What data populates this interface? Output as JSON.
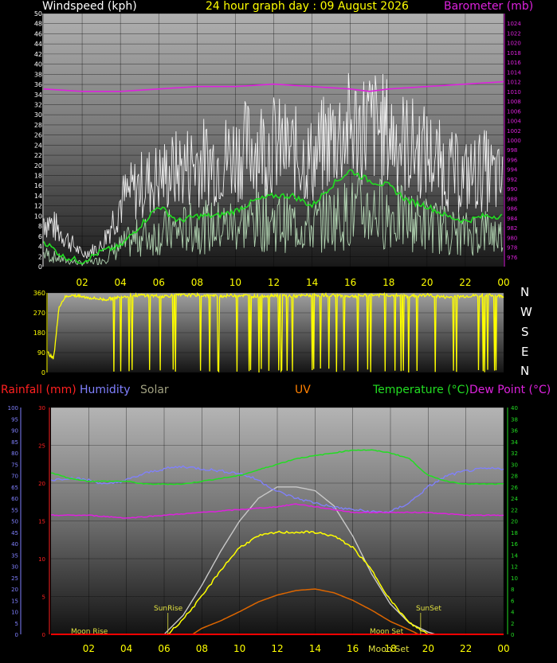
{
  "header": {
    "windspeed": "Windspeed (kph)",
    "title": "24 hour graph day : 09 August 2026",
    "barometer": "Barometer (mb)"
  },
  "compass": [
    "N",
    "W",
    "S",
    "E",
    "N"
  ],
  "legend": {
    "rainfall": "Rainfall (mm)",
    "humidity": "Humidity",
    "solar": "Solar",
    "uv": "UV",
    "temperature": "Temperature (°C)",
    "dewpoint": "Dew Point (°C)"
  },
  "annotations": {
    "sunrise": "SunRise",
    "sunset": "SunSet",
    "moonrise": "Moon Rise",
    "moonset": "Moon Set"
  },
  "colors": {
    "wind": "#ffffff",
    "avgwind": "#c8f0c8",
    "barometer": "#dd22dd",
    "direction": "#ffff00",
    "temperature": "#22dd22",
    "dewpoint": "#dd22dd",
    "humidity": "#8080ff",
    "solar": "#c8c8c8",
    "uv": "#dd6600",
    "rain": "#ff0000"
  },
  "chart_data": [
    {
      "type": "line",
      "x_ticks": [
        "02",
        "04",
        "06",
        "08",
        "10",
        "12",
        "14",
        "16",
        "18",
        "20",
        "22",
        "00"
      ],
      "x_range_hours": [
        0,
        24
      ],
      "ylim_left": [
        0,
        50
      ],
      "y_ticks_left": [
        0,
        2,
        4,
        6,
        8,
        10,
        12,
        14,
        16,
        18,
        20,
        22,
        24,
        26,
        28,
        30,
        32,
        34,
        36,
        38,
        40,
        42,
        44,
        46,
        48,
        50
      ],
      "ylim_right": [
        974,
        1026
      ],
      "y_ticks_right": [
        976,
        978,
        980,
        982,
        984,
        986,
        988,
        990,
        992,
        994,
        996,
        998,
        1000,
        1002,
        1004,
        1006,
        1008,
        1010,
        1012,
        1014,
        1016,
        1018,
        1020,
        1022,
        1024
      ],
      "series": [
        {
          "key": "wind_gust",
          "axis": "left",
          "x": [
            0,
            1,
            2,
            3,
            4,
            5,
            6,
            7,
            8,
            9,
            10,
            11,
            12,
            13,
            14,
            15,
            16,
            17,
            18,
            19,
            20,
            21,
            22,
            23,
            24
          ],
          "y": [
            12,
            8,
            3,
            5,
            16,
            20,
            22,
            24,
            26,
            26,
            28,
            30,
            30,
            28,
            26,
            32,
            34,
            35,
            33,
            30,
            28,
            24,
            22,
            24,
            20
          ]
        },
        {
          "key": "wind_speed",
          "axis": "left",
          "x": [
            0,
            1,
            2,
            3,
            4,
            5,
            6,
            7,
            8,
            9,
            10,
            11,
            12,
            13,
            14,
            15,
            16,
            17,
            18,
            19,
            20,
            21,
            22,
            23,
            24
          ],
          "y": [
            4,
            2,
            1,
            2,
            6,
            9,
            10,
            11,
            12,
            12,
            13,
            14,
            14,
            13,
            12,
            15,
            16,
            17,
            16,
            14,
            13,
            11,
            10,
            11,
            9
          ]
        },
        {
          "key": "avg_wind",
          "axis": "left",
          "x": [
            0,
            1,
            2,
            3,
            4,
            5,
            6,
            7,
            8,
            9,
            10,
            11,
            12,
            13,
            14,
            15,
            16,
            17,
            18,
            19,
            20,
            21,
            22,
            23,
            24
          ],
          "y": [
            5,
            2,
            1,
            3,
            4,
            8,
            12,
            9,
            10,
            10,
            11,
            13,
            14,
            14,
            12,
            16,
            19,
            17,
            16,
            13,
            12,
            10,
            9,
            10,
            10
          ]
        },
        {
          "key": "barometer",
          "axis": "right",
          "x": [
            0,
            2,
            4,
            6,
            8,
            10,
            12,
            14,
            16,
            17,
            18,
            20,
            22,
            24
          ],
          "y": [
            1010.5,
            1010,
            1010,
            1010.5,
            1011,
            1011,
            1011.5,
            1011,
            1010.5,
            1010,
            1010.5,
            1011,
            1011.5,
            1012
          ]
        }
      ]
    },
    {
      "type": "line",
      "x_range_hours": [
        0,
        24
      ],
      "ylim": [
        0,
        360
      ],
      "y_ticks": [
        0,
        90,
        180,
        270,
        360
      ],
      "series": [
        {
          "key": "wind_direction",
          "x": [
            0,
            0.3,
            0.6,
            0.9,
            1.2,
            2,
            3,
            4,
            5,
            6,
            7,
            8,
            9,
            10,
            11,
            12,
            13,
            14,
            15,
            16,
            17,
            18,
            19,
            20,
            21,
            22,
            23,
            24
          ],
          "y": [
            90,
            60,
            300,
            340,
            350,
            340,
            330,
            345,
            350,
            345,
            350,
            350,
            345,
            350,
            345,
            350,
            345,
            350,
            350,
            345,
            350,
            350,
            345,
            350,
            340,
            345,
            350,
            345
          ]
        }
      ]
    },
    {
      "type": "line",
      "x_ticks": [
        "02",
        "04",
        "06",
        "08",
        "10",
        "12",
        "14",
        "16",
        "18",
        "20",
        "22",
        "00"
      ],
      "x_range_hours": [
        0,
        24
      ],
      "ylim_rain": [
        0,
        30
      ],
      "y_ticks_rain": [
        0,
        5,
        10,
        15,
        20,
        25,
        30
      ],
      "ylim_humidity": [
        0,
        100
      ],
      "y_ticks_humidity": [
        0,
        5,
        10,
        15,
        20,
        25,
        30,
        35,
        40,
        45,
        50,
        55,
        60,
        65,
        70,
        75,
        80,
        85,
        90,
        95,
        100
      ],
      "ylim_temp": [
        0,
        40
      ],
      "y_ticks_temp": [
        0,
        2,
        4,
        6,
        8,
        10,
        12,
        14,
        16,
        18,
        20,
        22,
        24,
        26,
        28,
        30,
        32,
        34,
        36,
        38,
        40
      ],
      "series": [
        {
          "key": "temperature",
          "axis": "temp",
          "x": [
            0,
            1,
            2,
            3,
            4,
            5,
            6,
            7,
            8,
            9,
            10,
            11,
            12,
            13,
            14,
            15,
            16,
            17,
            18,
            19,
            20,
            21,
            22,
            23,
            24
          ],
          "y": [
            28.5,
            27.5,
            27,
            27,
            27,
            26.5,
            26.5,
            26.5,
            27,
            27.5,
            28,
            29,
            30,
            31,
            31.5,
            32,
            32.5,
            32.5,
            32,
            31,
            28,
            27,
            26.5,
            26.5,
            26.5
          ]
        },
        {
          "key": "dewpoint",
          "axis": "temp",
          "x": [
            0,
            2,
            4,
            6,
            8,
            10,
            12,
            13,
            14,
            15,
            16,
            18,
            20,
            22,
            24
          ],
          "y": [
            21,
            21,
            20.5,
            21,
            21.5,
            22,
            22.5,
            23,
            22.5,
            22,
            21.5,
            21.5,
            21.5,
            21,
            21
          ]
        },
        {
          "key": "humidity",
          "axis": "humidity",
          "x": [
            0,
            1,
            2,
            3,
            4,
            5,
            6,
            7,
            8,
            9,
            10,
            11,
            12,
            13,
            14,
            15,
            16,
            17,
            18,
            19,
            20,
            21,
            22,
            23,
            24
          ],
          "y": [
            68,
            69,
            68,
            66,
            68,
            71,
            73,
            74,
            73,
            72,
            71,
            68,
            63,
            60,
            58,
            56,
            55,
            54,
            54,
            58,
            65,
            70,
            72,
            73,
            73
          ]
        },
        {
          "key": "solar",
          "axis": "rain",
          "x": [
            6,
            7,
            8,
            9,
            10,
            11,
            12,
            13,
            14,
            15,
            16,
            17,
            18,
            19,
            20,
            20.4
          ],
          "y": [
            0,
            2.5,
            6.5,
            11,
            15,
            18,
            19.5,
            19.5,
            19,
            17,
            13,
            8,
            4,
            1.5,
            0.3,
            0
          ]
        },
        {
          "key": "uv",
          "axis": "rain",
          "x": [
            6.2,
            7,
            8,
            9,
            10,
            11,
            12,
            13,
            14,
            15,
            16,
            17,
            18,
            19,
            20
          ],
          "y": [
            0,
            2,
            5,
            8.5,
            11.5,
            13,
            13.5,
            13.5,
            13.5,
            13,
            11.5,
            8.5,
            4.5,
            1.5,
            0
          ]
        },
        {
          "key": "uv_index",
          "axis": "rain",
          "x": [
            7.5,
            8,
            9,
            10,
            11,
            12,
            13,
            14,
            15,
            16,
            17,
            18,
            19,
            19.5
          ],
          "y": [
            0,
            0.8,
            1.8,
            3,
            4.3,
            5.2,
            5.8,
            6,
            5.5,
            4.5,
            3.2,
            1.7,
            0.6,
            0
          ]
        },
        {
          "key": "rainfall",
          "axis": "rain",
          "x": [
            0,
            24
          ],
          "y": [
            0,
            0
          ]
        }
      ]
    }
  ]
}
